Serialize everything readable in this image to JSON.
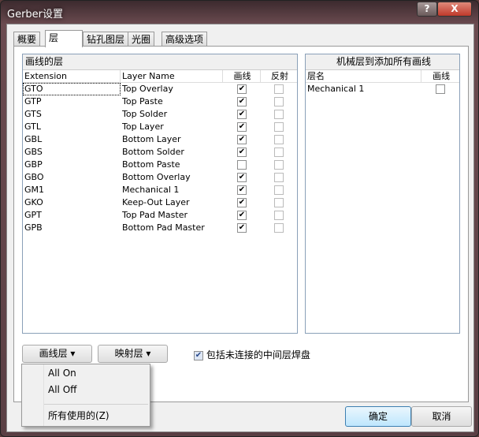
{
  "window": {
    "title": "Gerber设置",
    "help": "?",
    "close": "X"
  },
  "tabs": [
    "概要",
    "层",
    "钻孔图层",
    "光圈",
    "高级选项"
  ],
  "left": {
    "title": "画线的层",
    "columns": [
      "Extension",
      "Layer Name",
      "画线",
      "反射"
    ],
    "rows": [
      {
        "ext": "GTO",
        "name": "Top Overlay",
        "plot": true,
        "mirror": false
      },
      {
        "ext": "GTP",
        "name": "Top Paste",
        "plot": true,
        "mirror": false
      },
      {
        "ext": "GTS",
        "name": "Top Solder",
        "plot": true,
        "mirror": false
      },
      {
        "ext": "GTL",
        "name": "Top Layer",
        "plot": true,
        "mirror": false
      },
      {
        "ext": "GBL",
        "name": "Bottom Layer",
        "plot": true,
        "mirror": false
      },
      {
        "ext": "GBS",
        "name": "Bottom Solder",
        "plot": true,
        "mirror": false
      },
      {
        "ext": "GBP",
        "name": "Bottom Paste",
        "plot": false,
        "mirror": false
      },
      {
        "ext": "GBO",
        "name": "Bottom Overlay",
        "plot": true,
        "mirror": false
      },
      {
        "ext": "GM1",
        "name": "Mechanical 1",
        "plot": true,
        "mirror": false
      },
      {
        "ext": "GKO",
        "name": "Keep-Out Layer",
        "plot": true,
        "mirror": false
      },
      {
        "ext": "GPT",
        "name": "Top Pad Master",
        "plot": true,
        "mirror": false
      },
      {
        "ext": "GPB",
        "name": "Bottom Pad Master",
        "plot": true,
        "mirror": false
      }
    ]
  },
  "right": {
    "title": "机械层到添加所有画线",
    "columns": [
      "层名",
      "画线"
    ],
    "rows": [
      {
        "name": "Mechanical 1",
        "plot": false
      }
    ]
  },
  "buttons": {
    "plot_layers": "画线层 ▾",
    "mirror_layers": "映射层 ▾",
    "ok": "确定",
    "cancel": "取消"
  },
  "include_checkbox": {
    "label": "包括未连接的中间层焊盘",
    "checked": true
  },
  "menu": {
    "items": [
      "All On",
      "All Off",
      "所有使用的(Z)"
    ]
  }
}
